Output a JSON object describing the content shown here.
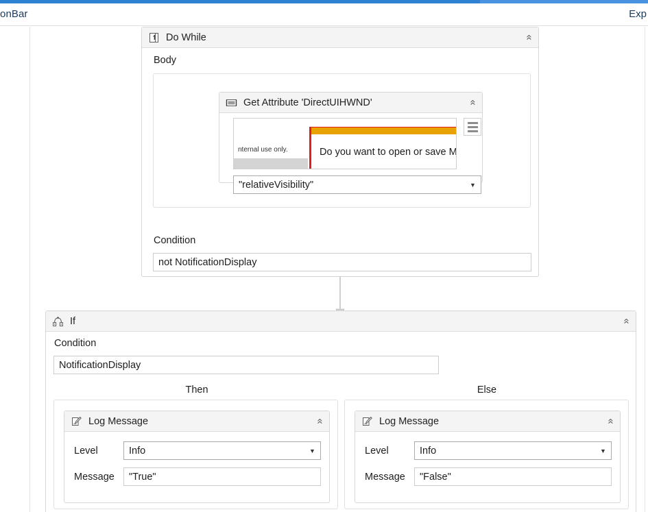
{
  "window": {
    "accent_color": "#3a8ade",
    "ribbon_tab_left": "onBar",
    "ribbon_tab_right": "Exp"
  },
  "workflow": {
    "do_while": {
      "title": "Do While",
      "icon": "do-while-icon",
      "collapse_glyph": "«",
      "body_label": "Body",
      "condition_label": "Condition",
      "condition_value": "not NotificationDisplay",
      "get_attribute": {
        "title": "Get Attribute 'DirectUIHWND'",
        "icon": "get-attribute-icon",
        "collapse_glyph": "«",
        "menu_icon": "hamburger-menu-icon",
        "attribute_value": "\"relativeVisibility\"",
        "dropdown_glyph": "▼",
        "preview": {
          "partial_text": "nternal use only.",
          "notification_text": "Do you want to open or save M",
          "stripe_color": "#e8a200",
          "highlight_color": "#e02020"
        }
      }
    },
    "connector": {
      "icon": "down-arrow-connector-icon",
      "color": "#cfcfcf"
    },
    "if_block": {
      "title": "If",
      "icon": "if-branch-icon",
      "collapse_glyph": "«",
      "condition_label": "Condition",
      "condition_value": "NotificationDisplay",
      "then_label": "Then",
      "else_label": "Else",
      "then_activity": {
        "title": "Log Message",
        "icon": "log-message-icon",
        "collapse_glyph": "«",
        "level_label": "Level",
        "level_value": "Info",
        "dropdown_glyph": "▼",
        "message_label": "Message",
        "message_value": "\"True\""
      },
      "else_activity": {
        "title": "Log Message",
        "icon": "log-message-icon",
        "collapse_glyph": "«",
        "level_label": "Level",
        "level_value": "Info",
        "dropdown_glyph": "▼",
        "message_label": "Message",
        "message_value": "\"False\""
      }
    }
  }
}
